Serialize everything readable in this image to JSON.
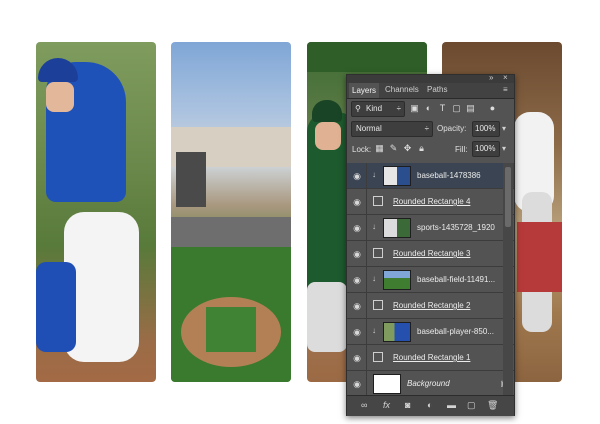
{
  "panel": {
    "tabs": [
      "Layers",
      "Channels",
      "Paths"
    ],
    "filter_kind": "Kind",
    "blend_mode": "Normal",
    "opacity_label": "Opacity:",
    "opacity_value": "100%",
    "lock_label": "Lock:",
    "fill_label": "Fill:",
    "fill_value": "100%",
    "layers": [
      {
        "name": "baseball-1478386",
        "type": "image",
        "selected": true
      },
      {
        "name": "Rounded Rectangle 4",
        "type": "shape",
        "selected": false
      },
      {
        "name": "sports-1435728_1920",
        "type": "image",
        "selected": false
      },
      {
        "name": "Rounded Rectangle 3",
        "type": "shape",
        "selected": false
      },
      {
        "name": "baseball-field-11491...",
        "type": "image",
        "selected": false
      },
      {
        "name": "Rounded Rectangle 2",
        "type": "shape",
        "selected": false
      },
      {
        "name": "baseball-player-850...",
        "type": "image",
        "selected": false
      },
      {
        "name": "Rounded Rectangle 1",
        "type": "shape",
        "selected": false
      },
      {
        "name": "Background",
        "type": "background",
        "selected": false
      }
    ],
    "footer_icons": [
      "link-icon",
      "fx-icon",
      "mask-icon",
      "adjustment-icon",
      "folder-icon",
      "new-layer-icon",
      "trash-icon"
    ]
  },
  "strips": [
    "baseball-player-blue-uniform",
    "baseball-stadium-sky",
    "baseball-player-green-uniform",
    "baseball-player-sliding"
  ]
}
